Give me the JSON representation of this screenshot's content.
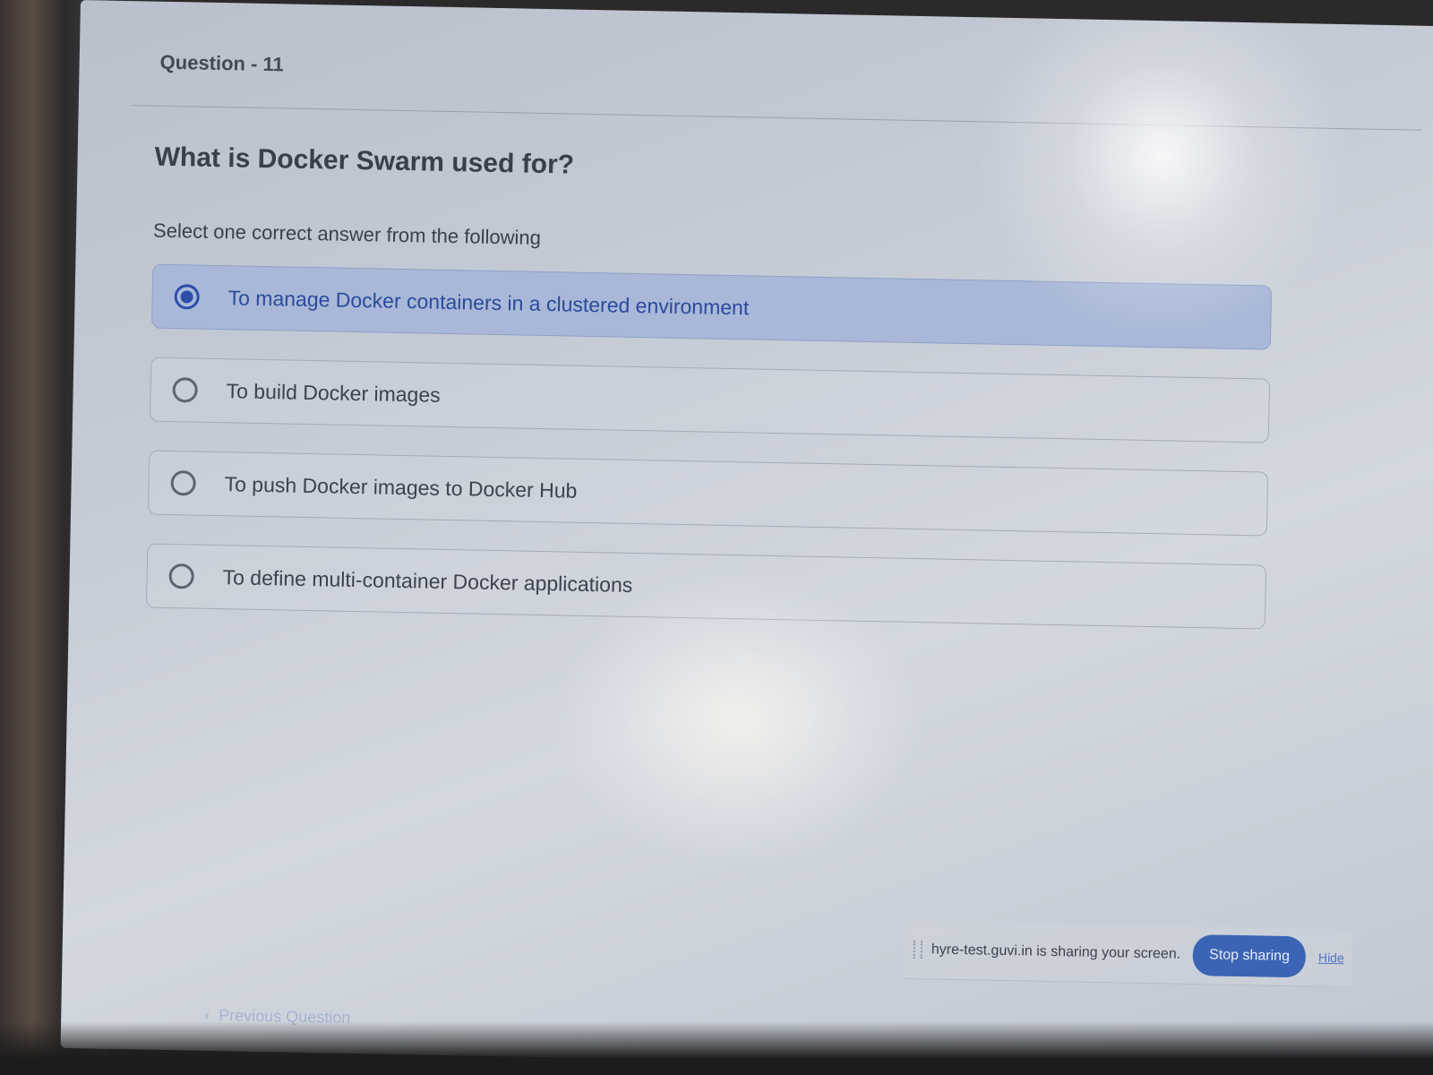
{
  "question": {
    "number_label": "Question - 11",
    "text": "What is Docker Swarm used for?",
    "instruction": "Select one correct answer from the following",
    "options": [
      {
        "label": "To manage Docker containers in a clustered environment",
        "selected": true
      },
      {
        "label": "To build Docker images",
        "selected": false
      },
      {
        "label": "To push Docker images to Docker Hub",
        "selected": false
      },
      {
        "label": "To define multi-container Docker applications",
        "selected": false
      }
    ]
  },
  "screen_share": {
    "message": "hyre-test.guvi.in is sharing your screen.",
    "stop_label": "Stop sharing",
    "hide_label": "Hide"
  },
  "navigation": {
    "previous_label": "Previous Question",
    "previous_icon": "chevron-left-icon"
  },
  "colors": {
    "accent": "#2d4ea8",
    "selected_bg": "#a9b8d8",
    "button": "#3b64b5"
  }
}
